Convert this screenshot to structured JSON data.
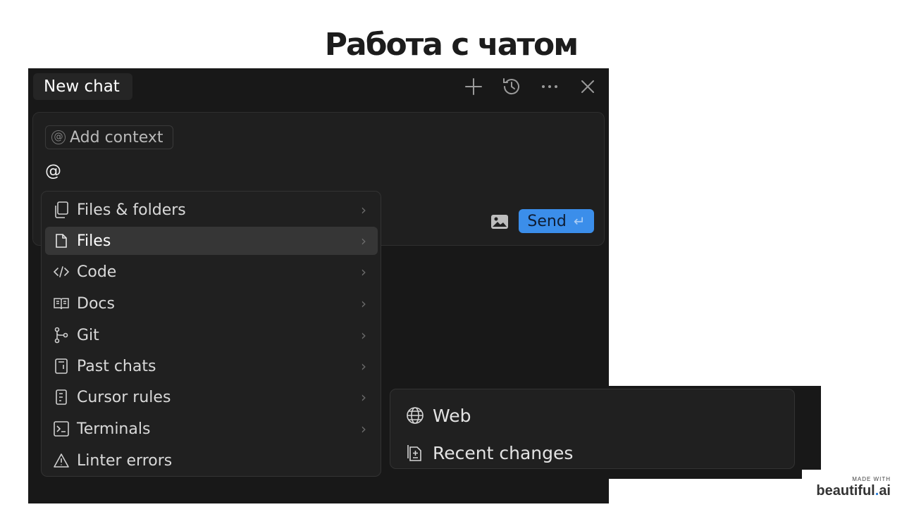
{
  "slide": {
    "title": "Работа с чатом"
  },
  "chat": {
    "tab_label": "New chat",
    "header_icons": [
      "plus-icon",
      "history-icon",
      "more-icon",
      "close-icon"
    ],
    "composer": {
      "add_context_label": "Add context",
      "input_text": "@",
      "send_label": "Send",
      "send_color": "#3b8eea"
    }
  },
  "mention_menu": {
    "items": [
      {
        "label": "Files & folders",
        "icon": "files-folders-icon",
        "has_submenu": true
      },
      {
        "label": "Files",
        "icon": "file-icon",
        "has_submenu": true,
        "selected": true
      },
      {
        "label": "Code",
        "icon": "code-icon",
        "has_submenu": true
      },
      {
        "label": "Docs",
        "icon": "book-icon",
        "has_submenu": true
      },
      {
        "label": "Git",
        "icon": "git-branch-icon",
        "has_submenu": true
      },
      {
        "label": "Past chats",
        "icon": "chat-history-icon",
        "has_submenu": true
      },
      {
        "label": "Cursor rules",
        "icon": "rules-icon",
        "has_submenu": true
      },
      {
        "label": "Terminals",
        "icon": "terminal-icon",
        "has_submenu": true
      },
      {
        "label": "Linter errors",
        "icon": "warning-icon",
        "has_submenu": false
      }
    ]
  },
  "sub_menu": {
    "items": [
      {
        "label": "Web",
        "icon": "globe-icon"
      },
      {
        "label": "Recent changes",
        "icon": "diff-icon"
      }
    ]
  },
  "branding": {
    "made_with": "MADE WITH",
    "name_main": "beautiful",
    "name_dot": ".",
    "name_suffix": "ai",
    "accent": "#2b7fd8"
  }
}
